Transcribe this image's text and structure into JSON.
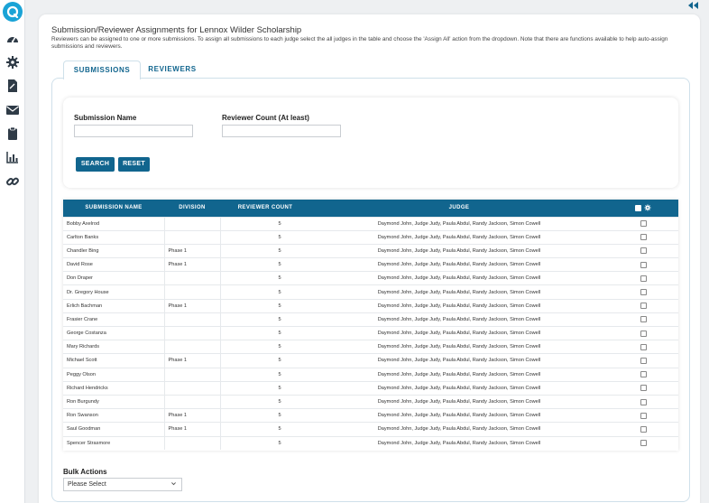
{
  "header": {
    "title": "Submission/Reviewer Assignments for Lennox Wilder Scholarship",
    "description": "Reviewers can be assigned to one or more submissions. To assign all submissions to each judge select the all judges in the table and choose the 'Assign All' action from the dropdown. Note that there are functions available to help auto-assign submissions and reviewers."
  },
  "sidebar": {
    "icons": [
      "dashboard-icon",
      "gear-icon",
      "document-icon",
      "envelope-icon",
      "clipboard-icon",
      "bar-chart-icon",
      "link-icon"
    ]
  },
  "tabs": [
    {
      "label": "SUBMISSIONS",
      "active": true
    },
    {
      "label": "REVIEWERS",
      "active": false
    }
  ],
  "search": {
    "submission_name_label": "Submission Name",
    "submission_name_value": "",
    "reviewer_count_label": "Reviewer Count (At least)",
    "reviewer_count_value": "",
    "search_label": "SEARCH",
    "reset_label": "RESET"
  },
  "table": {
    "columns": [
      "SUBMISSION NAME",
      "DIVISION",
      "REVIEWER COUNT",
      "JUDGE"
    ],
    "rows": [
      {
        "name": "Bobby Axelrod",
        "division": "",
        "count": "5",
        "judge": "Daymond John, Judge Judy, Paula Abdul, Randy Jackson, Simon Cowell"
      },
      {
        "name": "Carlton Banks",
        "division": "",
        "count": "5",
        "judge": "Daymond John, Judge Judy, Paula Abdul, Randy Jackson, Simon Cowell"
      },
      {
        "name": "Chandler Bing",
        "division": "Phase 1",
        "count": "5",
        "judge": "Daymond John, Judge Judy, Paula Abdul, Randy Jackson, Simon Cowell"
      },
      {
        "name": "David Rose",
        "division": "Phase 1",
        "count": "5",
        "judge": "Daymond John, Judge Judy, Paula Abdul, Randy Jackson, Simon Cowell"
      },
      {
        "name": "Don Draper",
        "division": "",
        "count": "5",
        "judge": "Daymond John, Judge Judy, Paula Abdul, Randy Jackson, Simon Cowell"
      },
      {
        "name": "Dr. Gregory House",
        "division": "",
        "count": "5",
        "judge": "Daymond John, Judge Judy, Paula Abdul, Randy Jackson, Simon Cowell"
      },
      {
        "name": "Erlich Bachman",
        "division": "Phase 1",
        "count": "5",
        "judge": "Daymond John, Judge Judy, Paula Abdul, Randy Jackson, Simon Cowell"
      },
      {
        "name": "Frasier Crane",
        "division": "",
        "count": "5",
        "judge": "Daymond John, Judge Judy, Paula Abdul, Randy Jackson, Simon Cowell"
      },
      {
        "name": "George Costanza",
        "division": "",
        "count": "5",
        "judge": "Daymond John, Judge Judy, Paula Abdul, Randy Jackson, Simon Cowell"
      },
      {
        "name": "Mary Richards",
        "division": "",
        "count": "5",
        "judge": "Daymond John, Judge Judy, Paula Abdul, Randy Jackson, Simon Cowell"
      },
      {
        "name": "Michael Scott",
        "division": "Phase 1",
        "count": "5",
        "judge": "Daymond John, Judge Judy, Paula Abdul, Randy Jackson, Simon Cowell"
      },
      {
        "name": "Peggy Olson",
        "division": "",
        "count": "5",
        "judge": "Daymond John, Judge Judy, Paula Abdul, Randy Jackson, Simon Cowell"
      },
      {
        "name": "Richard Hendricks",
        "division": "",
        "count": "5",
        "judge": "Daymond John, Judge Judy, Paula Abdul, Randy Jackson, Simon Cowell"
      },
      {
        "name": "Ron Burgundy",
        "division": "",
        "count": "5",
        "judge": "Daymond John, Judge Judy, Paula Abdul, Randy Jackson, Simon Cowell"
      },
      {
        "name": "Ron Swanson",
        "division": "Phase 1",
        "count": "5",
        "judge": "Daymond John, Judge Judy, Paula Abdul, Randy Jackson, Simon Cowell"
      },
      {
        "name": "Saul Goodman",
        "division": "Phase 1",
        "count": "5",
        "judge": "Daymond John, Judge Judy, Paula Abdul, Randy Jackson, Simon Cowell"
      },
      {
        "name": "Spencer Strasmore",
        "division": "",
        "count": "5",
        "judge": "Daymond John, Judge Judy, Paula Abdul, Randy Jackson, Simon Cowell"
      }
    ]
  },
  "bulk_actions": {
    "label": "Bulk Actions",
    "selected": "Please Select"
  },
  "colors": {
    "accent": "#11658e",
    "logo": "#1aa3d6"
  }
}
